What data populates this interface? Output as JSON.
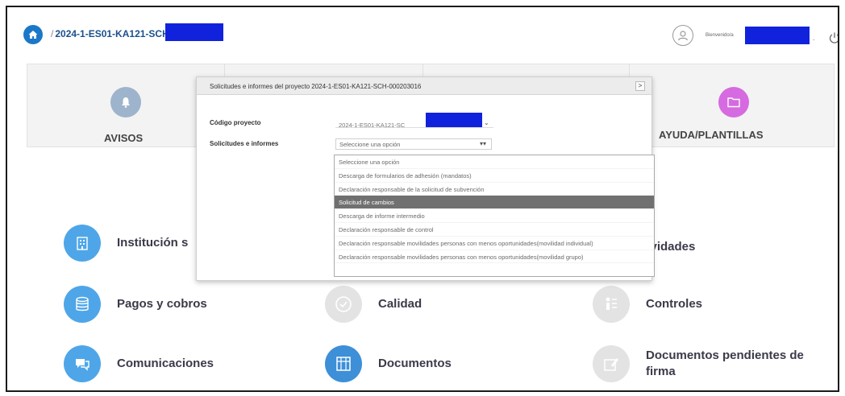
{
  "header": {
    "breadcrumb": "2024-1-ES01-KA121-SCH",
    "welcome": "Bienvenido/a",
    "welcome_suffix": "."
  },
  "cards": {
    "avisos": "AVISOS",
    "ayuda": "AYUDA/PLANTILLAS"
  },
  "menu": {
    "institucion": "Institución s",
    "actividades": "ctividades",
    "pagos": "Pagos y cobros",
    "calidad": "Calidad",
    "controles": "Controles",
    "comunicaciones": "Comunicaciones",
    "documentos": "Documentos",
    "pendientes_line1": "Documentos pendientes de",
    "pendientes_line2": "firma"
  },
  "modal": {
    "title": "Solicitudes e informes del proyecto 2024-1-ES01-KA121-SCH-000203016",
    "close": ">",
    "codigo_label": "Código proyecto",
    "codigo_value": "2024-1-ES01-KA121-SC",
    "solicitudes_label": "Solicitudes e informes",
    "select_placeholder": "Seleccione una opción",
    "options": [
      "Seleccione una opción",
      "Descarga de formularios de adhesión (mandatos)",
      "Declaración responsable de la solicitud de subvención",
      "Solicitud de cambios",
      "Descarga de informe intermedio",
      "Declaración responsable de control",
      "Declaración responsable movilidades personas con menos oportunidades(movilidad individual)",
      "Declaración responsable movilidades personas con menos oportunidades(movilidad grupo)"
    ],
    "selected_option": "Solicitud de cambios"
  },
  "colors": {
    "accent": "#1b78c8",
    "redaction": "#1122dd",
    "menu_icon_blue": "#4ea6e8",
    "menu_icon_grey": "#e3e3e3",
    "ayuda_icon": "#d66ae0",
    "avisos_icon": "#9eb3cc",
    "selected_option_bg": "#707070"
  }
}
